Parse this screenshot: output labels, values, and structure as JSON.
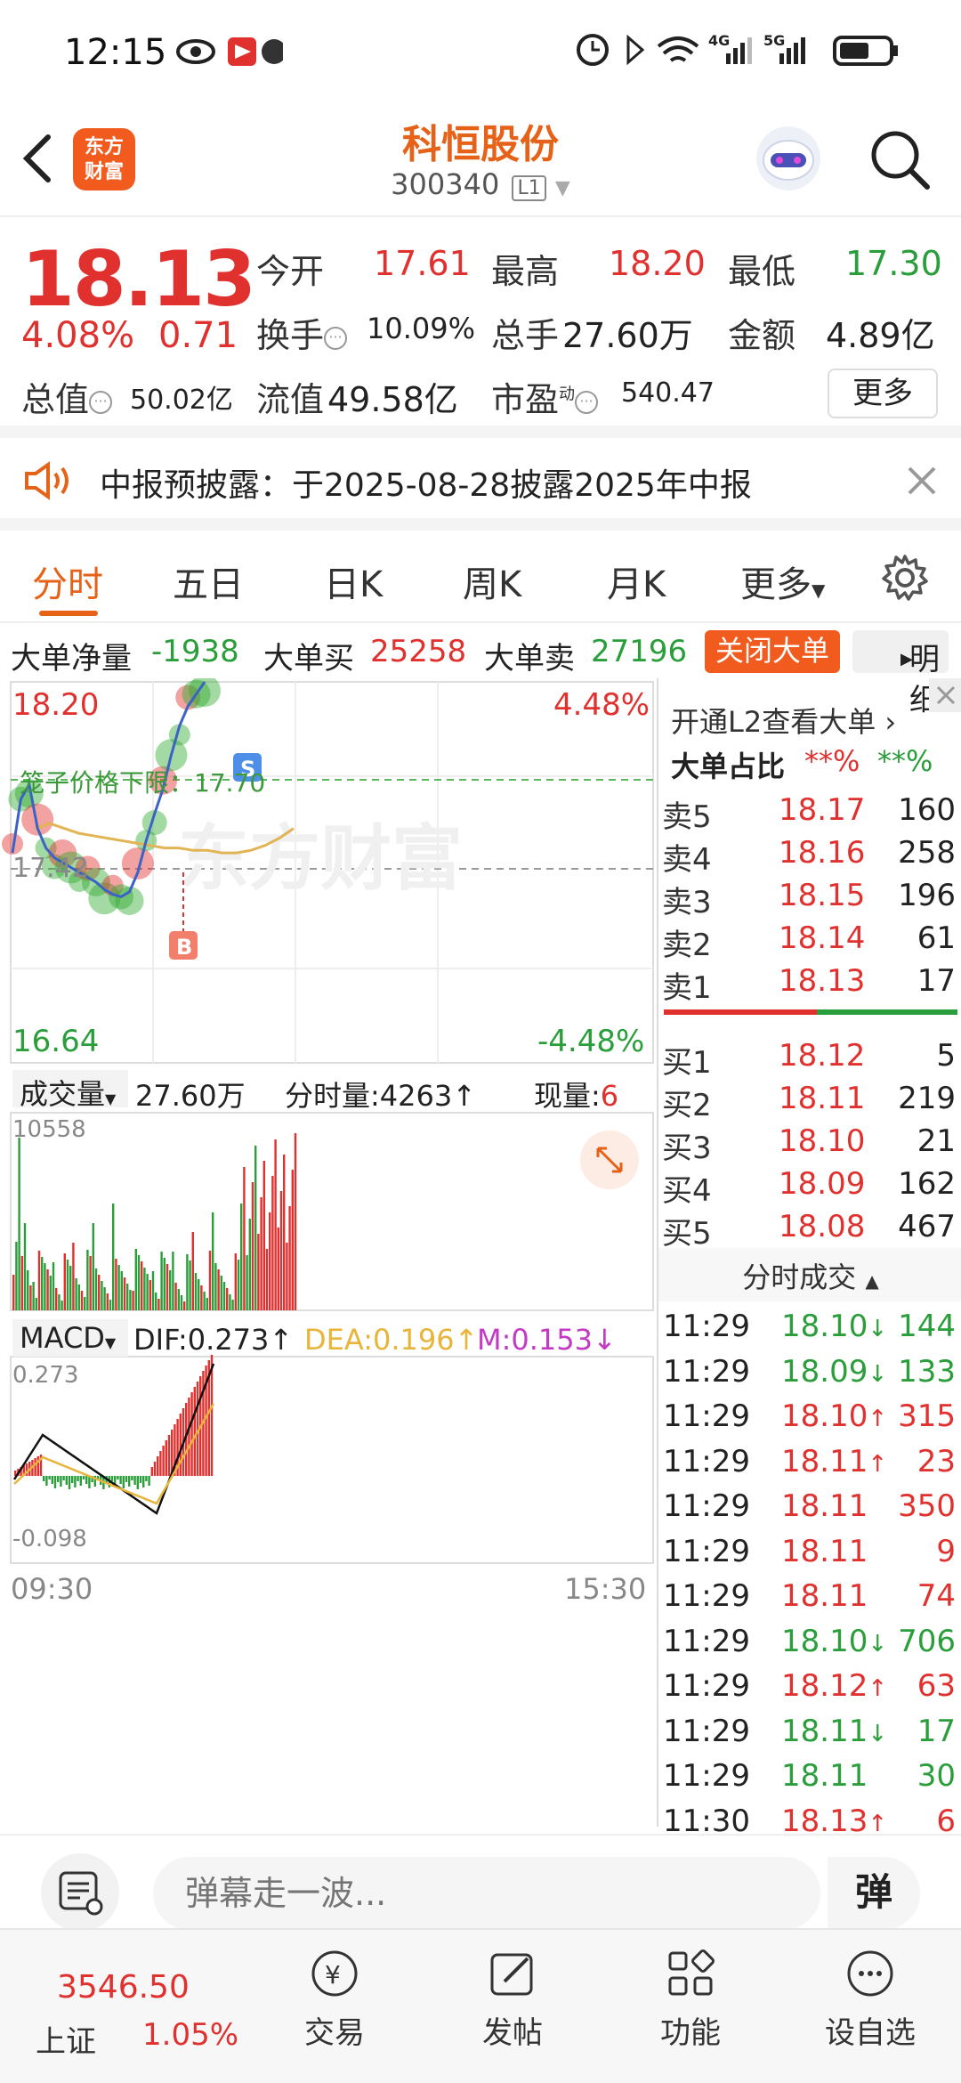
{
  "status_bar": {
    "time": "12:15",
    "network": "4G",
    "network2": "5G"
  },
  "header": {
    "logo_text": "东方\n财富",
    "logo_line1": "东方",
    "logo_line2": "财富",
    "title": "科恒股份",
    "code": "300340",
    "level": "L1"
  },
  "quote": {
    "price": "18.13",
    "change_pct": "4.08%",
    "change": "0.71",
    "open_label": "今开",
    "open": "17.61",
    "high_label": "最高",
    "high": "18.20",
    "low_label": "最低",
    "low": "17.30",
    "turnover_label": "换手",
    "turnover": "10.09%",
    "volume_label": "总手",
    "volume": "27.60万",
    "amount_label": "金额",
    "amount": "4.89亿",
    "mktcap_label": "总值",
    "mktcap": "50.02亿",
    "float_label": "流值",
    "float": "49.58亿",
    "pe_label": "市盈",
    "pe_sup": "动",
    "pe": "540.47",
    "more": "更多"
  },
  "notice": {
    "text": "中报预披露：于2025-08-28披露2025年中报"
  },
  "tabs": [
    "分时",
    "五日",
    "日K",
    "周K",
    "月K",
    "更多"
  ],
  "dadan": {
    "net_label": "大单净量",
    "net": "-1938",
    "buy_label": "大单买",
    "buy": "25258",
    "sell_label": "大单卖",
    "sell": "27196",
    "close": "关闭大单",
    "detail": "明细"
  },
  "chart": {
    "y_top": "18.20",
    "y_top_pct": "4.48%",
    "y_bottom": "16.64",
    "y_bottom_pct": "-4.48%",
    "base_price": "17.42",
    "lower_limit_label": "笼子价格下限：17.70",
    "watermark": "东方财富",
    "b_marker": "B",
    "s_marker": "S",
    "volume_label": "成交量",
    "volume_total": "27.60万",
    "minute_vol": "分时量:4263↑",
    "now_vol_label": "现量:",
    "now_vol": "6",
    "vol_max": "10558",
    "macd_label": "MACD",
    "dif": "DIF:0.273↑",
    "dea": "DEA:0.196↑",
    "m": "M:0.153↓",
    "macd_top": "0.273",
    "macd_bottom": "-0.098",
    "time_start": "09:30",
    "time_end": "15:30"
  },
  "chart_data": {
    "type": "line",
    "title": "",
    "x_range": [
      "09:30",
      "15:30"
    ],
    "ylim": [
      16.64,
      18.2
    ],
    "base": 17.42,
    "series": [
      {
        "values": [
          17.5,
          17.72,
          17.78,
          17.6,
          17.52,
          17.48,
          17.46,
          17.44,
          17.42,
          17.4,
          17.38,
          17.35,
          17.33,
          17.32,
          17.34,
          17.42,
          17.55,
          17.66,
          17.76,
          17.9,
          18.02,
          18.1,
          18.15,
          18.2
        ]
      },
      {
        "values": [
          17.6,
          17.62,
          17.6,
          17.58,
          17.57,
          17.56,
          17.55,
          17.54,
          17.53,
          17.52,
          17.52,
          17.51,
          17.51,
          17.5,
          17.5,
          17.51,
          17.53,
          17.56,
          17.6
        ]
      }
    ]
  },
  "panel": {
    "l2_text": "开通L2查看大单",
    "ratio_label": "大单占比",
    "ratio_buy": "**%",
    "ratio_sell": "**%",
    "asks": [
      {
        "label": "卖5",
        "price": "18.17",
        "vol": "160"
      },
      {
        "label": "卖4",
        "price": "18.16",
        "vol": "258"
      },
      {
        "label": "卖3",
        "price": "18.15",
        "vol": "196"
      },
      {
        "label": "卖2",
        "price": "18.14",
        "vol": "61"
      },
      {
        "label": "卖1",
        "price": "18.13",
        "vol": "17"
      }
    ],
    "bids": [
      {
        "label": "买1",
        "price": "18.12",
        "vol": "5"
      },
      {
        "label": "买2",
        "price": "18.11",
        "vol": "219"
      },
      {
        "label": "买3",
        "price": "18.10",
        "vol": "21"
      },
      {
        "label": "买4",
        "price": "18.09",
        "vol": "162"
      },
      {
        "label": "买5",
        "price": "18.08",
        "vol": "467"
      }
    ],
    "trades_title": "分时成交",
    "trades": [
      {
        "t": "11:29",
        "p": "18.10",
        "d": "↓",
        "v": "144",
        "c": "green"
      },
      {
        "t": "11:29",
        "p": "18.09",
        "d": "↓",
        "v": "133",
        "c": "green"
      },
      {
        "t": "11:29",
        "p": "18.10",
        "d": "↑",
        "v": "315",
        "c": "red"
      },
      {
        "t": "11:29",
        "p": "18.11",
        "d": "↑",
        "v": "23",
        "c": "red"
      },
      {
        "t": "11:29",
        "p": "18.11",
        "d": "",
        "v": "350",
        "c": "red"
      },
      {
        "t": "11:29",
        "p": "18.11",
        "d": "",
        "v": "9",
        "c": "red"
      },
      {
        "t": "11:29",
        "p": "18.11",
        "d": "",
        "v": "74",
        "c": "red"
      },
      {
        "t": "11:29",
        "p": "18.10",
        "d": "↓",
        "v": "706",
        "c": "green"
      },
      {
        "t": "11:29",
        "p": "18.12",
        "d": "↑",
        "v": "63",
        "c": "red"
      },
      {
        "t": "11:29",
        "p": "18.11",
        "d": "↓",
        "v": "17",
        "c": "green"
      },
      {
        "t": "11:29",
        "p": "18.11",
        "d": "",
        "v": "30",
        "c": "green"
      },
      {
        "t": "11:30",
        "p": "18.13",
        "d": "↑",
        "v": "6",
        "c": "red"
      }
    ]
  },
  "danmu": {
    "placeholder": "弹幕走一波...",
    "btn": "弹"
  },
  "tabbar": {
    "index_value": "3546.50",
    "index_name": "上证",
    "index_pct": "1.05%",
    "items": [
      "交易",
      "发帖",
      "功能",
      "设自选"
    ]
  },
  "colors": {
    "up": "#e0312f",
    "down": "#2a9e3a",
    "brand": "#f25b1e"
  }
}
